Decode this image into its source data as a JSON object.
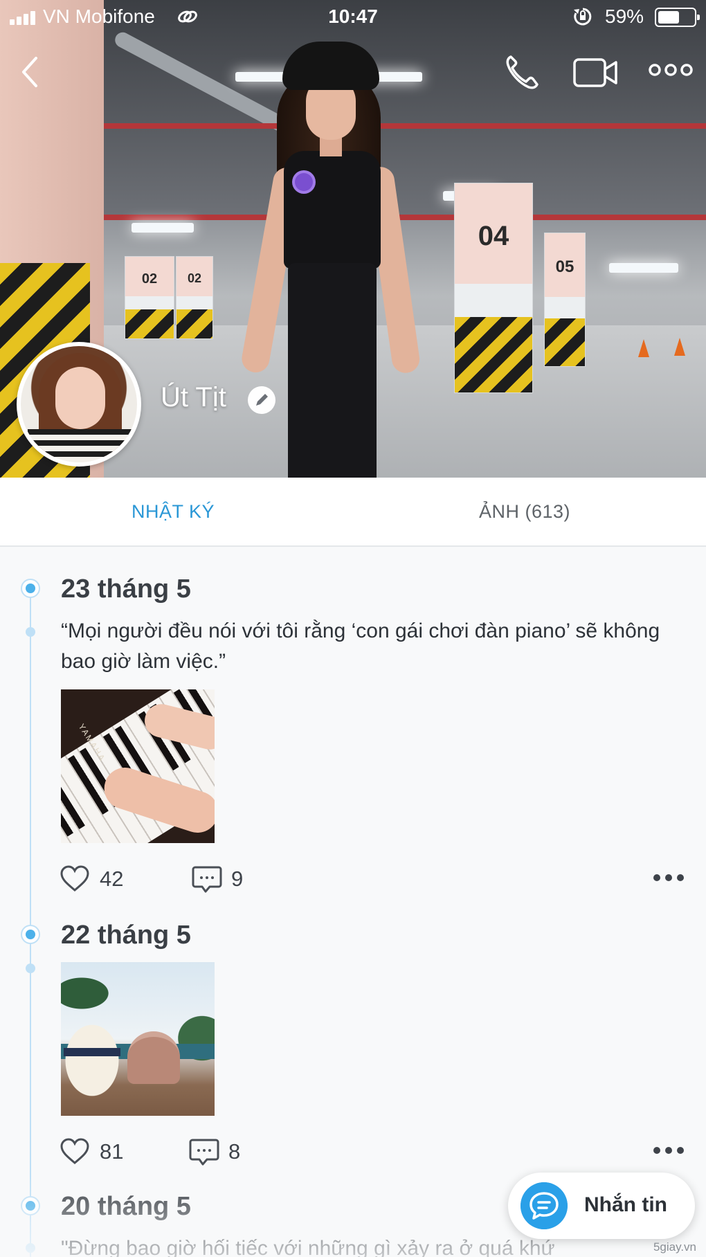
{
  "status_bar": {
    "carrier": "VN Mobifone",
    "time": "10:47",
    "battery_percent": "59%",
    "battery_level": 0.59,
    "icons": [
      "signal-icon",
      "link-icon",
      "rotation-lock-icon",
      "battery-icon"
    ]
  },
  "header": {
    "icons": [
      "back-icon",
      "phone-icon",
      "video-call-icon",
      "more-icon"
    ]
  },
  "profile": {
    "name": "Út Tịt",
    "edit_icon": "pencil-icon"
  },
  "tabs": [
    {
      "label": "NHẬT KÝ",
      "active": true
    },
    {
      "label": "ẢNH (613)",
      "active": false
    }
  ],
  "posts": [
    {
      "date": "23 tháng 5",
      "text": "“Mọi người đều nói với tôi rằng ‘con gái chơi đàn piano’ sẽ không bao giờ làm việc.”",
      "photo": "piano",
      "photo_brand": "YAMAHA",
      "likes": "42",
      "comments": "9"
    },
    {
      "date": "22 tháng 5",
      "text": "",
      "photo": "beach",
      "likes": "81",
      "comments": "8"
    },
    {
      "date": "20 tháng 5",
      "text": "\"Đừng bao giờ hối tiếc với những gì xảy ra ở quá khứ"
    }
  ],
  "message_button": {
    "label": "Nhắn tin",
    "icon": "chat-bubble-icon"
  },
  "watermark": "5giay.vn",
  "colors": {
    "accent": "#2a97d6",
    "timeline": "#bfe0f6",
    "fab": "#2aa0e8"
  }
}
